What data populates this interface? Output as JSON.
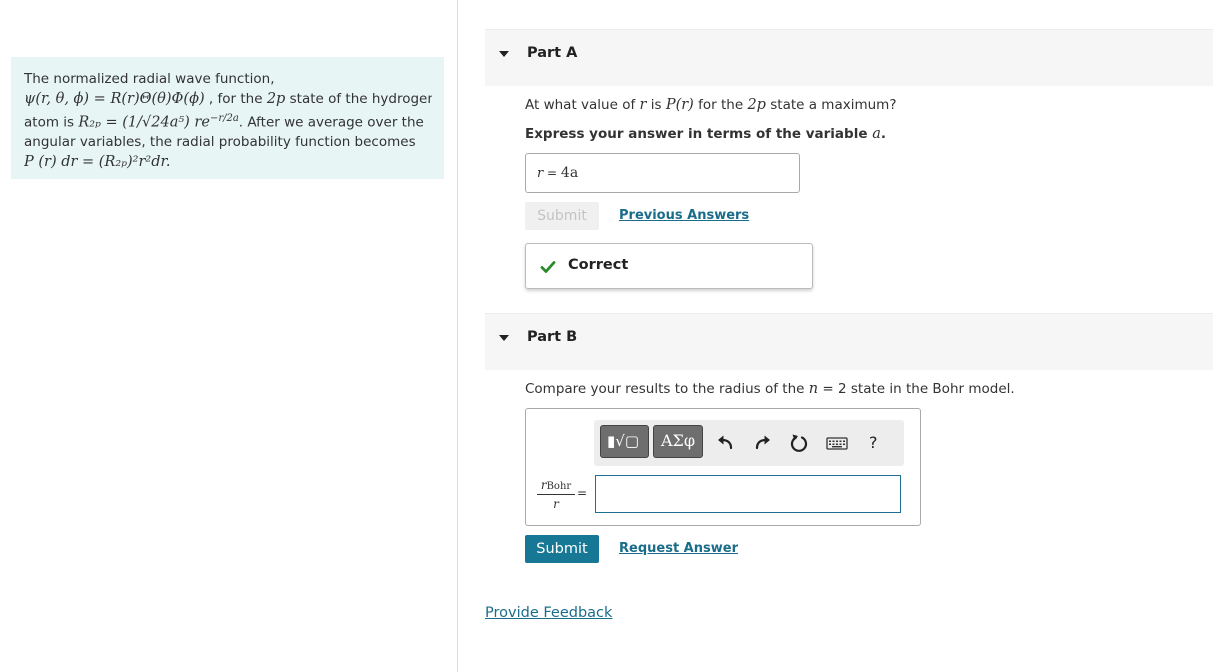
{
  "problem": {
    "line1": "The normalized radial wave function,",
    "line2_math": "ψ(r, θ, ϕ) = R(r)Θ(θ)Φ(ϕ)",
    "line2_text": " , for the ",
    "line2_math2": "2p",
    "line2_text2": " state of the hydrogen",
    "line3_text": "atom is ",
    "line3_math": "R₂ₚ = (1/√24a⁵) re",
    "line3_sup": "−r/2a",
    "line3_text2": ". After we average over the",
    "line4": "angular variables, the radial probability function becomes",
    "line5_math": "P (r) dr = (R₂ₚ)²r²dr."
  },
  "partA": {
    "title": "Part A",
    "question_pre": "At what value of ",
    "question_r": "r",
    "question_mid": " is ",
    "question_P": "P(r)",
    "question_mid2": " for the ",
    "question_2p": "2p",
    "question_post": " state a maximum?",
    "instruction_pre": "Express your answer in terms of the variable ",
    "instruction_var": "a",
    "instruction_post": ".",
    "answer_label": "r",
    "answer_eq": " = ",
    "answer_value": "4a",
    "submit_label": "Submit",
    "previous_answers_label": "Previous Answers",
    "feedback_label": "Correct"
  },
  "partB": {
    "title": "Part B",
    "question_pre": "Compare your results to the radius of the ",
    "question_n": "n",
    "question_post": " = 2 state in the Bohr model.",
    "toolbar": {
      "templates_label": "▮√▢",
      "symbols_label": "ΑΣφ",
      "help_label": "?"
    },
    "fraction_numerator": "rBohr",
    "fraction_denominator": "r",
    "equals_label": "=",
    "input_value": "",
    "submit_label": "Submit",
    "request_answer_label": "Request Answer"
  },
  "feedback_link": "Provide Feedback",
  "colors": {
    "accent": "#167894",
    "link": "#1a6d8a",
    "correct_check": "#2a8a2a",
    "problem_bg": "#e7f5f5"
  }
}
